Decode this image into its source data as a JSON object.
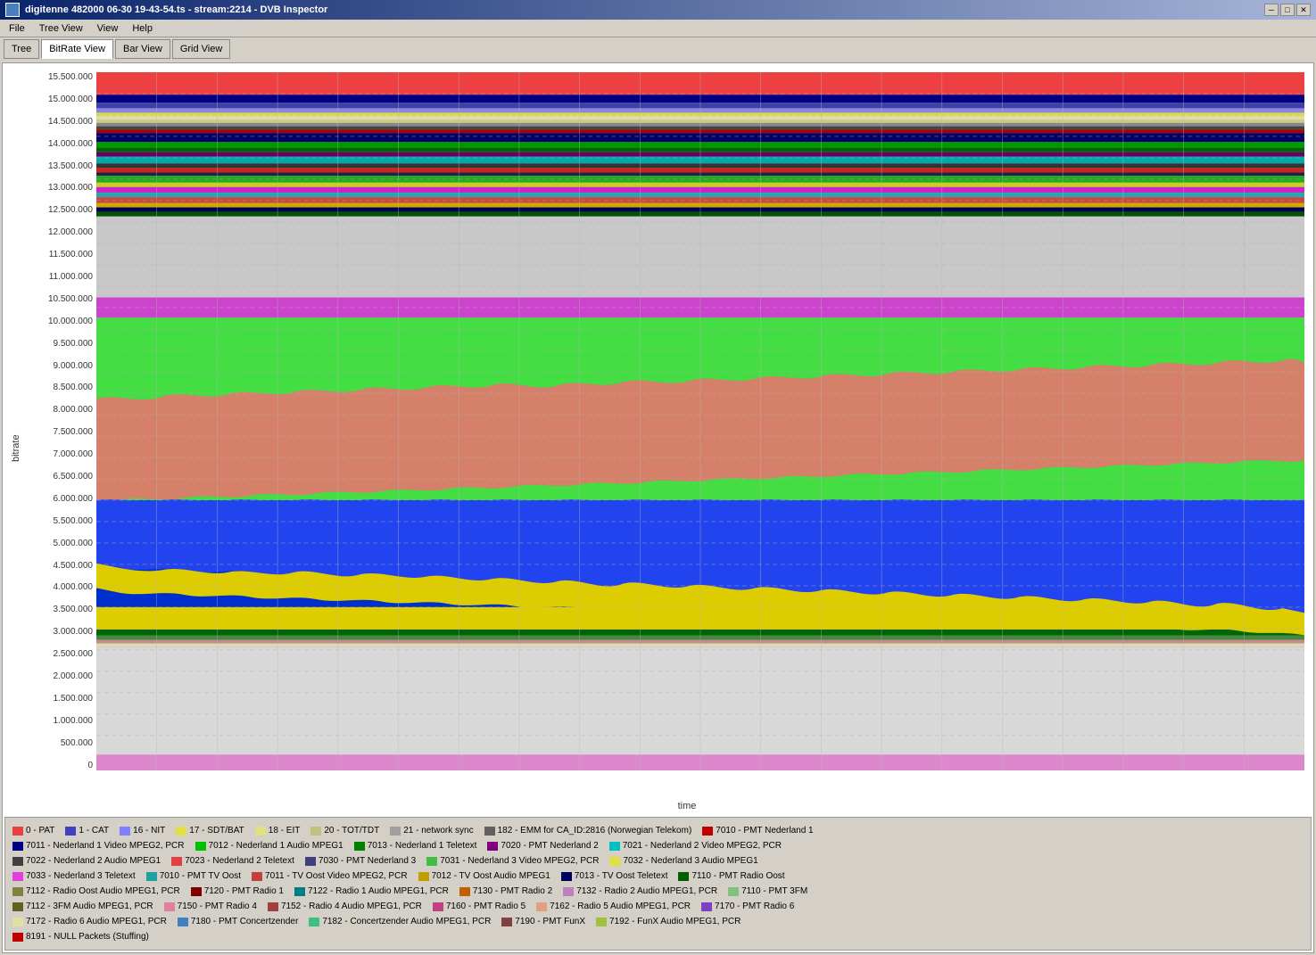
{
  "titleBar": {
    "title": "digitenne 482000 06-30 19-43-54.ts - stream:2214 - DVB Inspector",
    "minBtn": "─",
    "maxBtn": "□",
    "closeBtn": "✕"
  },
  "menu": {
    "items": [
      "File",
      "Tree View",
      "View",
      "Help"
    ]
  },
  "toolbar": {
    "tabs": [
      {
        "label": "Tree",
        "active": false
      },
      {
        "label": "BitRate View",
        "active": true
      },
      {
        "label": "Bar View",
        "active": false
      },
      {
        "label": "Grid View",
        "active": false
      }
    ]
  },
  "chart": {
    "yAxisValues": [
      "15.500.000",
      "15.000.000",
      "14.500.000",
      "14.000.000",
      "13.500.000",
      "13.000.000",
      "12.500.000",
      "12.000.000",
      "11.500.000",
      "11.000.000",
      "10.500.000",
      "10.000.000",
      "9.500.000",
      "9.000.000",
      "8.500.000",
      "8.000.000",
      "7.500.000",
      "7.000.000",
      "6.500.000",
      "6.000.000",
      "5.500.000",
      "5.000.000",
      "4.500.000",
      "4.000.000",
      "3.500.000",
      "3.000.000",
      "2.500.000",
      "2.000.000",
      "1.500.000",
      "1.000.000",
      "500.000",
      "0"
    ],
    "yLabel": "bitrate",
    "xLabel": "time"
  },
  "legend": {
    "rows": [
      [
        {
          "color": "#e8504a",
          "label": "0 - PAT"
        },
        {
          "color": "#4040c0",
          "label": "1 - CAT"
        },
        {
          "color": "#8080ff",
          "label": "16 - NIT"
        },
        {
          "color": "#e8e840",
          "label": "17 - SDT/BAT"
        },
        {
          "color": "#e0e080",
          "label": "18 - EIT"
        },
        {
          "color": "#c0c080",
          "label": "20 - TOT/TDT"
        },
        {
          "color": "#a0a0a0",
          "label": "21 - network sync"
        },
        {
          "color": "#606060",
          "label": "182 - EMM for CA_ID:2816 (Norwegian Telekom)"
        },
        {
          "color": "#c00000",
          "label": "7010 - PMT Nederland 1"
        }
      ],
      [
        {
          "color": "#000080",
          "label": "7011 - Nederland 1 Video MPEG2, PCR"
        },
        {
          "color": "#00c000",
          "label": "7012 - Nederland 1 Audio MPEG1"
        },
        {
          "color": "#008000",
          "label": "7013 - Nederland 1 Teletext"
        },
        {
          "color": "#800080",
          "label": "7020 - PMT Nederland 2"
        },
        {
          "color": "#00c0c0",
          "label": "7021 - Nederland 2 Video MPEG2, PCR"
        }
      ],
      [
        {
          "color": "#404040",
          "label": "7022 - Nederland 2 Audio MPEG1"
        },
        {
          "color": "#e04040",
          "label": "7023 - Nederland 2 Teletext"
        },
        {
          "color": "#404080",
          "label": "7030 - PMT Nederland 3"
        },
        {
          "color": "#40c040",
          "label": "7031 - Nederland 3 Video MPEG2, PCR"
        },
        {
          "color": "#e0e040",
          "label": "7032 - Nederland 3 Audio MPEG1"
        }
      ],
      [
        {
          "color": "#e040e0",
          "label": "7033 - Nederland 3 Teletext"
        },
        {
          "color": "#20a0a0",
          "label": "7010 - PMT TV Oost"
        },
        {
          "color": "#c04040",
          "label": "7011 - TV Oost Video MPEG2, PCR"
        },
        {
          "color": "#c0a000",
          "label": "7012 - TV Oost Audio MPEG1"
        },
        {
          "color": "#000060",
          "label": "7013 - TV Oost Teletext"
        },
        {
          "color": "#006000",
          "label": "7110 - PMT Radio Oost"
        }
      ],
      [
        {
          "color": "#808040",
          "label": "7112 - Radio Oost Audio MPEG1, PCR"
        },
        {
          "color": "#800000",
          "label": "7120 - PMT Radio 1"
        },
        {
          "color": "#008080",
          "label": "7122 - Radio 1 Audio MPEG1, PCR"
        },
        {
          "color": "#c06000",
          "label": "7130 - PMT Radio 2"
        },
        {
          "color": "#c080c0",
          "label": "7132 - Radio 2 Audio MPEG1, PCR"
        },
        {
          "color": "#80c080",
          "label": "7110 - PMT 3FM"
        }
      ],
      [
        {
          "color": "#606020",
          "label": "7112 - 3FM Audio MPEG1, PCR"
        },
        {
          "color": "#e080a0",
          "label": "7150 - PMT Radio 4"
        },
        {
          "color": "#a04040",
          "label": "7152 - Radio 4 Audio MPEG1, PCR"
        },
        {
          "color": "#c04080",
          "label": "7160 - PMT Radio 5"
        },
        {
          "color": "#e0a080",
          "label": "7162 - Radio 5 Audio MPEG1, PCR"
        },
        {
          "color": "#8040c0",
          "label": "7170 - PMT Radio 6"
        }
      ],
      [
        {
          "color": "#e0e0a0",
          "label": "7172 - Radio 6 Audio MPEG1, PCR"
        },
        {
          "color": "#4080c0",
          "label": "7180 - PMT Concertzender"
        },
        {
          "color": "#40c080",
          "label": "7182 - Concertzender Audio MPEG1, PCR"
        },
        {
          "color": "#804040",
          "label": "7190 - PMT FunX"
        },
        {
          "color": "#a0c040",
          "label": "7192 - FunX Audio MPEG1, PCR"
        }
      ],
      [
        {
          "color": "#c00000",
          "label": "8191 - NULL Packets (Stuffing)"
        }
      ]
    ]
  }
}
